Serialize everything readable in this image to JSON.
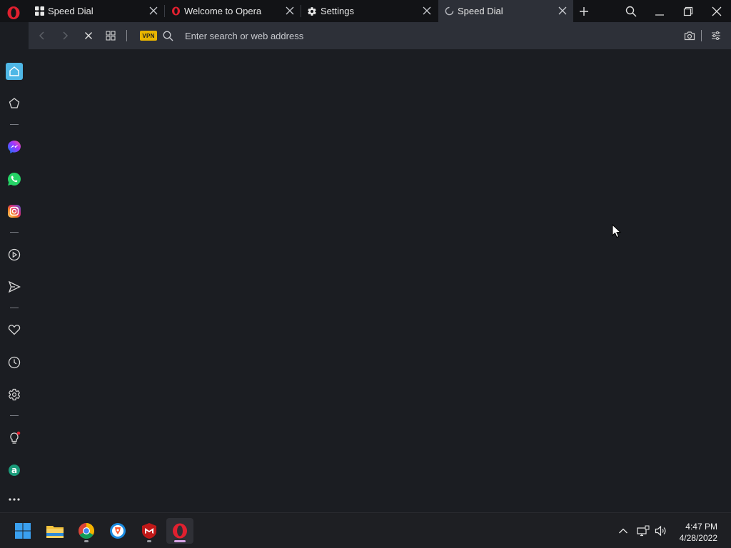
{
  "browser": {
    "tabs": [
      {
        "title": "Speed Dial",
        "icon": "speed-dial-grid-icon",
        "active": false
      },
      {
        "title": "Welcome to Opera",
        "icon": "opera-logo-icon",
        "active": false
      },
      {
        "title": "Settings",
        "icon": "gear-icon",
        "active": false
      },
      {
        "title": "Speed Dial",
        "icon": "loading-spinner-icon",
        "active": true
      }
    ],
    "address_bar": {
      "vpn_label": "VPN",
      "placeholder": "Enter search or web address",
      "value": ""
    },
    "sidebar": {
      "items": [
        {
          "name": "home",
          "icon": "home-icon"
        },
        {
          "name": "bookmarks",
          "icon": "star-icon"
        },
        {
          "name": "messenger",
          "icon": "messenger-icon"
        },
        {
          "name": "whatsapp",
          "icon": "whatsapp-icon"
        },
        {
          "name": "instagram",
          "icon": "instagram-icon"
        },
        {
          "name": "player",
          "icon": "play-circle-icon"
        },
        {
          "name": "my-flow",
          "icon": "send-icon"
        },
        {
          "name": "pinboards",
          "icon": "heart-icon"
        },
        {
          "name": "history",
          "icon": "clock-icon"
        },
        {
          "name": "settings",
          "icon": "gear-icon"
        },
        {
          "name": "tips",
          "icon": "lightbulb-icon"
        },
        {
          "name": "aria",
          "icon": "aria-icon"
        },
        {
          "name": "more",
          "icon": "more-icon"
        }
      ]
    }
  },
  "taskbar": {
    "apps": [
      {
        "name": "start",
        "icon": "windows-start-icon"
      },
      {
        "name": "file-explorer",
        "icon": "folder-icon"
      },
      {
        "name": "chrome",
        "icon": "chrome-icon"
      },
      {
        "name": "brave",
        "icon": "brave-icon"
      },
      {
        "name": "mcafee",
        "icon": "mcafee-icon"
      },
      {
        "name": "opera",
        "icon": "opera-icon"
      }
    ],
    "clock": {
      "time": "4:47 PM",
      "date": "4/28/2022"
    }
  },
  "colors": {
    "accent": "#4fb7e6",
    "opera_red": "#e0202f",
    "vpn_yellow": "#e8b400",
    "background": "#1b1d22",
    "tab_active": "#2d3038"
  }
}
